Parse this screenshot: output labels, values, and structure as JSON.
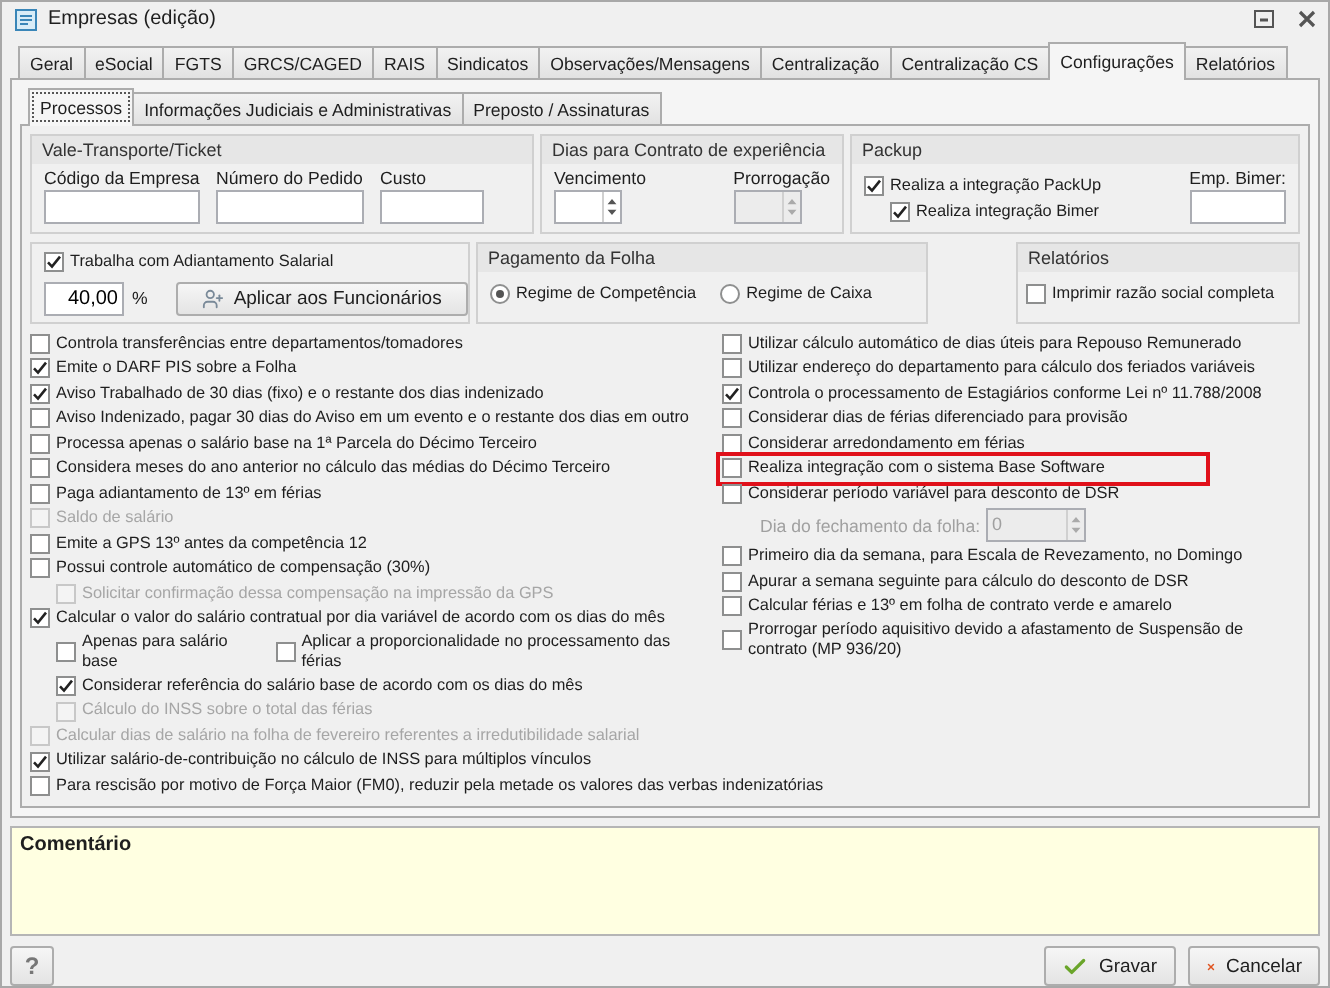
{
  "window": {
    "title": "Empresas (edição)"
  },
  "tabs": [
    {
      "label": "Geral",
      "selected": false
    },
    {
      "label": "eSocial",
      "selected": false
    },
    {
      "label": "FGTS",
      "selected": false
    },
    {
      "label": "GRCS/CAGED",
      "selected": false
    },
    {
      "label": "RAIS",
      "selected": false
    },
    {
      "label": "Sindicatos",
      "selected": false
    },
    {
      "label": "Observações/Mensagens",
      "selected": false
    },
    {
      "label": "Centralização",
      "selected": false
    },
    {
      "label": "Centralização CS",
      "selected": false
    },
    {
      "label": "Configurações",
      "selected": true
    },
    {
      "label": "Relatórios",
      "selected": false
    }
  ],
  "subtabs": [
    {
      "label": "Processos",
      "selected": true
    },
    {
      "label": "Informações Judiciais e Administrativas",
      "selected": false
    },
    {
      "label": "Preposto / Assinaturas",
      "selected": false
    }
  ],
  "vale_transporte": {
    "title": "Vale-Transporte/Ticket",
    "fields": [
      {
        "label": "Código da Empresa"
      },
      {
        "label": "Número do Pedido"
      },
      {
        "label": "Custo"
      }
    ]
  },
  "contrato_experiencia": {
    "title": "Dias para Contrato de experiência",
    "fields": [
      {
        "label": "Vencimento",
        "disabled": false
      },
      {
        "label": "Prorrogação",
        "disabled": true
      }
    ]
  },
  "packup": {
    "title": "Packup",
    "options": [
      {
        "label": "Realiza a integração PackUp",
        "checked": true,
        "children": [
          {
            "label": "Realiza integração Bimer",
            "checked": true
          }
        ]
      }
    ],
    "field": {
      "label": "Emp. Bimer:"
    }
  },
  "adiantamento": {
    "label": "Trabalha com Adiantamento Salarial",
    "checked": true,
    "value": "40,00",
    "unit": "%",
    "button": "Aplicar aos Funcionários"
  },
  "pagamento_folha": {
    "title": "Pagamento da Folha",
    "options": [
      {
        "label": "Regime de Competência",
        "selected": true
      },
      {
        "label": "Regime de Caixa",
        "selected": false
      }
    ]
  },
  "relatorios": {
    "title": "Relatórios",
    "options": [
      {
        "label": "Imprimir razão social completa",
        "checked": false
      }
    ]
  },
  "options_left": [
    {
      "label": "Controla transferências entre departamentos/tomadores",
      "checked": false,
      "disabled": false
    },
    {
      "label": "Emite o DARF PIS sobre a Folha",
      "checked": true,
      "disabled": false
    },
    {
      "label": "Aviso Trabalhado de 30 dias (fixo) e o restante dos dias indenizado",
      "checked": true,
      "disabled": false
    },
    {
      "label": "Aviso Indenizado, pagar 30 dias do Aviso em um evento e o restante dos dias em outro",
      "checked": false,
      "disabled": false
    },
    {
      "label": "Processa apenas o salário base na 1ª Parcela do Décimo Terceiro",
      "checked": false,
      "disabled": false
    },
    {
      "label": "Considera meses do ano anterior no cálculo das médias do Décimo Terceiro",
      "checked": false,
      "disabled": false
    },
    {
      "label": "Paga adiantamento de 13º em férias",
      "checked": false,
      "disabled": false
    },
    {
      "label": "Saldo de salário",
      "checked": false,
      "disabled": true
    },
    {
      "label": "Emite a GPS 13º antes da competência 12",
      "checked": false,
      "disabled": false
    },
    {
      "label": "Possui controle automático de compensação (30%)",
      "checked": false,
      "disabled": false,
      "children": [
        {
          "kind": "line",
          "label": "Solicitar confirmação dessa compensação na impressão da GPS",
          "checked": false,
          "disabled": true
        }
      ]
    },
    {
      "label": "Calcular o valor do salário contratual por dia variável de acordo com os dias do mês",
      "checked": true,
      "disabled": false,
      "children": [
        {
          "kind": "inline",
          "label": "Apenas para salário base",
          "checked": false,
          "disabled": false
        },
        {
          "kind": "inline",
          "label": "Aplicar a proporcionalidade no processamento das férias",
          "checked": false,
          "disabled": false
        },
        {
          "kind": "line",
          "label": "Considerar referência do salário base de acordo com os dias do mês",
          "checked": true,
          "disabled": false
        },
        {
          "kind": "line",
          "label": "Cálculo do INSS sobre o total das férias",
          "checked": false,
          "disabled": true
        }
      ]
    },
    {
      "label": "Calcular dias de salário na folha de fevereiro referentes a irredutibilidade salarial",
      "checked": false,
      "disabled": true
    },
    {
      "label": "Utilizar salário-de-contribuição no cálculo de INSS para múltiplos vínculos",
      "checked": true,
      "disabled": false
    }
  ],
  "options_right": [
    {
      "label": "Utilizar cálculo automático de dias úteis para Repouso Remunerado",
      "checked": false,
      "highlighted": false
    },
    {
      "label": "Utilizar endereço do departamento para cálculo dos feriados variáveis",
      "checked": false,
      "highlighted": false
    },
    {
      "label": "Controla o processamento de Estagiários conforme Lei nº 11.788/2008",
      "checked": true,
      "highlighted": false
    },
    {
      "label": "Considerar dias de férias diferenciado para provisão",
      "checked": false,
      "highlighted": false
    },
    {
      "label": "Considerar arredondamento em férias",
      "checked": false,
      "highlighted": false
    },
    {
      "label": "Realiza integração com o sistema Base Software",
      "checked": false,
      "highlighted": true
    },
    {
      "label": "Considerar período variável para desconto de DSR",
      "checked": false,
      "highlighted": false,
      "children": [
        {
          "kind": "spin",
          "label": "Dia do fechamento da folha:",
          "value": "0",
          "disabled": true
        }
      ]
    },
    {
      "label": "Primeiro dia da semana, para Escala de Revezamento, no Domingo",
      "checked": false,
      "highlighted": false
    },
    {
      "label": "Apurar a semana seguinte para cálculo do desconto de DSR",
      "checked": false,
      "highlighted": false
    },
    {
      "label": "Calcular férias e 13º em folha de contrato verde e amarelo",
      "checked": false,
      "highlighted": false
    },
    {
      "label": "Prorrogar período aquisitivo devido a afastamento de Suspensão de contrato (MP 936/20)",
      "checked": false,
      "highlighted": false
    }
  ],
  "options_bottom": [
    {
      "label": "Para rescisão por motivo de Força Maior (FM0), reduzir pela metade os valores das verbas indenizatórias",
      "checked": false
    }
  ],
  "comment": {
    "label": "Comentário"
  },
  "buttons": [
    {
      "kind": "help",
      "label": "?"
    },
    {
      "kind": "save",
      "label": "Gravar"
    },
    {
      "kind": "cancel",
      "label": "Cancelar"
    }
  ]
}
